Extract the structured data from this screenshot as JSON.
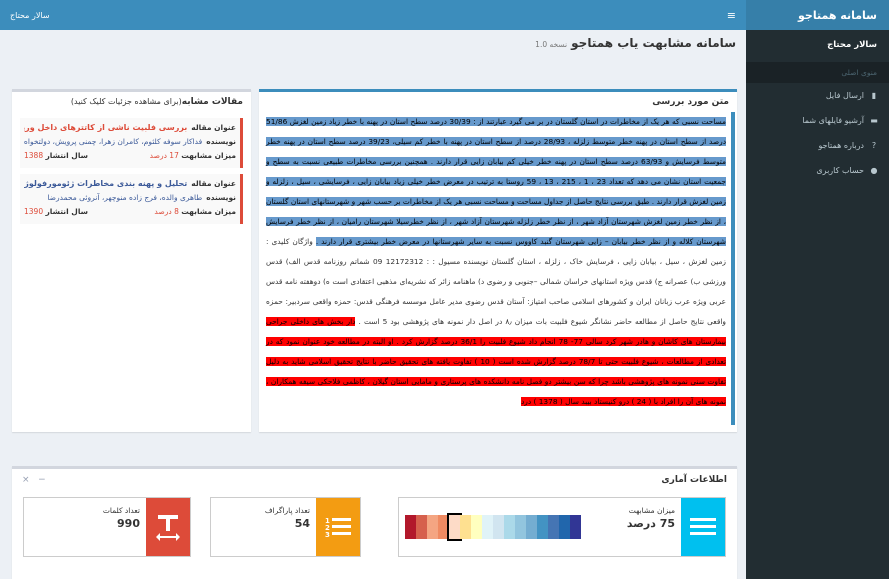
{
  "header": {
    "username": "سالار محتاج",
    "menu_glyph": "≡"
  },
  "sidebar": {
    "brand": "سامانه همتاجو",
    "user_name": "سالار محتاج",
    "menu_header": "منوی اصلی",
    "items": [
      {
        "label": "ارسال فایل",
        "icon": "file-icon",
        "glyph": "▮"
      },
      {
        "label": "آرشیو فایلهای شما",
        "icon": "archive-icon",
        "glyph": "▬"
      },
      {
        "label": "درباره همتاجو",
        "icon": "question-icon",
        "glyph": "?"
      },
      {
        "label": "حساب کاربری",
        "icon": "user-icon",
        "glyph": "●"
      }
    ]
  },
  "page": {
    "title": "سامانه مشابهت یاب همتاجو",
    "version": "نسخه 1.0"
  },
  "text_panel": {
    "title": "متن مورد بررسی",
    "segments": [
      {
        "style": "blue",
        "text": "مساحت نسبی که هر یک از مخاطرات در استان گلستان در بر می گیرد عبارتند از : 30/39 درصد سطح استان در پهنه با خطر زیاد زمین لغزش 51/86 درصد از سطح استان در پهنه خطر متوسط زلزله ، 28/93 درصد از سطح استان در پهنه با خطر کم سیلی، 39/23 درصد سطح استان در پهنه خطر متوسط فرسایش و 63/93 درصد سطح استان در پهنه خطر خیلی کم بیابان زایی قرار دارند . همچنین بررسی مخاطرات طبیعی نسبت به سطح و جمعیت استان نشان می دهد که تعداد 23 ، 1 ، 215 ، 13 ، 59 روستا به ترتیب در معرض خطر خیلی زیاد بیابان زایی ، فرسایشی ، سیل ، زلزله و زمین لغزش قرار دارند . طبق بررسی نتایج حاصل از جداول مساحت و مساحت نسبی هر یک از مخاطرات بر حسب شهر و شهرستانهای استان گلستان ، از نظر خطر زمین لغزش شهرستان آزاد شهر ، از نظر خطر زلزله شهرستان آزاد شهر ، از نظر خطرسیلا شهرستان رامیان ، از نظر خطر فرسایش شهرستان کلاله و از نظر خطر بیابان – زایی شهرستان گنبد کاووس نسبت به سایر شهرستانها در معرض خطر بیشتری قرار دارند ."
      },
      {
        "style": "none",
        "text": " واژگان کلیدی : زمین لغزش ، سیل ، بیابان زایی ، فرسایش خاک ، زلزله ، استان گلستان نویسنده مسیول : : 12172312 09 شماتم روزنامه قدس الف) قدس ورزشی ب) عصرانه ج) قدس ویژه استانهای خراسان شمالی –جنوبی و رضوی د) ماهنامه زائر که نشریه‌ای مذهبی اعتقادی است ه) دوهفته نامه قدس عربی ویژه عرب زبانان ایران و کشورهای اسلامی صاحب امتیاز: آستان قدس رضوی مدیر عامل موسسه فرهنگی قدس: حمزه واقعی سردبیر: حمزه واقعی نتایج حاصل از مطالعه حاضر نشانگر شیوع فلبیت بات میزان ۸٫ در اصل دار نمونه های پژوهشی بود 5 است . "
      },
      {
        "style": "red",
        "text": "دار بخش های داخلی جراحی بیمارستان های کاشان و هادر شهر کرد سالی 77- 78 انجام داد شیوع فلبیت را 36/1 درصد گزارش کرد . او البته در مطالعه خود عنوان نمود که در تعدادی از مطالعات ، شیوع فلبیت حتی تا 78/7 درصد گزارش شده است ( 10 ) تفاوت یافته های تحقیق حاضر با نتایج تحقیق اسلامی شاید به دلیل تفاوت سنی نمونه های پژوهشی باشد چرا که سن بیشتر دو فصل نامه دانشکده های پرستاری و مامایی استان گیلان ، کاظمی فلاحکی سیفه همکاران ، نمونه های آن را افراد با ( 24 ) درو کنیستاد بیبد سال ( 1378 ) درد"
      }
    ]
  },
  "articles_panel": {
    "title": "مقالات مشابه",
    "subtitle": "(برای مشاهده جزئیات کلیک کنید)",
    "labels": {
      "title": "عنوان مقاله",
      "authors": "نویسنده",
      "similarity": "میزان مشابهت",
      "year": "سال انتشار"
    },
    "items": [
      {
        "title": "بررسی فلبیت ناشی از کاتترهای داخل وریدهای ...",
        "authors": "فداکار سوفه کلثوم، کامران زهرا، چمنی پرویش، دولتخواه نس...",
        "similarity": "17 درصد",
        "year": "1388"
      },
      {
        "title": "تحلیل و پهنه بندی مخاطرات ژئومورفولوژیک استا...",
        "authors": "طاهری والده، فرج زاده منوچهر، آنروئی محمدرضا",
        "similarity": "8 درصد",
        "year": "1390"
      }
    ]
  },
  "stats": {
    "title": "اطلاعات آماری",
    "tools": {
      "close": "×",
      "minimize": "−"
    },
    "similarity": {
      "label": "میزان مشابهت",
      "value": "75 درصد",
      "icon": "lines-icon",
      "icon_bg": "#00c0ef"
    },
    "paragraphs": {
      "label": "تعداد پاراگراف",
      "value": "54",
      "icon": "numbered-list-icon",
      "icon_bg": "#f39c12"
    },
    "words": {
      "label": "تعداد کلمات",
      "value": "990",
      "icon": "text-size-icon",
      "icon_bg": "#dd4b39"
    },
    "scale_colors": [
      "#b2182b",
      "#d6604d",
      "#f4a582",
      "#ef8a62",
      "#fddbc7",
      "#fee090",
      "#ffffbf",
      "#e0f3f8",
      "#d1e5f0",
      "#abd9e9",
      "#92c5de",
      "#74add1",
      "#4393c3",
      "#4575b4",
      "#2166ac",
      "#313695"
    ],
    "scale_selected_index": 4
  }
}
